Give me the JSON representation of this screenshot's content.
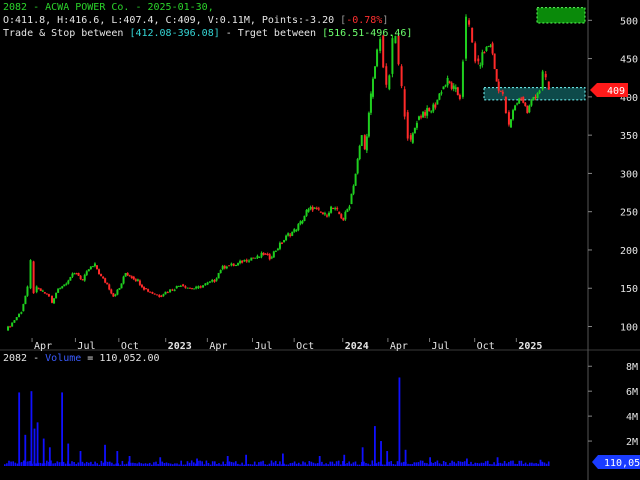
{
  "header": {
    "line1": "2082 - ACWA POWER Co. - 2025-01-30,",
    "ohlc": "O:411.8, H:416.6, L:407.4, C:409, V:0.11M, Points:-3.20 ",
    "pct_open": "[",
    "pct": "-0.78%",
    "pct_close": "]",
    "line3_a": "Trade & Stop between ",
    "stop_range": "[412.08-396.08]",
    "line3_b": " - Trget between ",
    "target_range": "[516.51-496.46]"
  },
  "volume_header": {
    "symbol": "2082 - ",
    "label": "Volume",
    "value": " = 110,052.00"
  },
  "colors": {
    "up": "#1fcf1f",
    "down": "#ff2a2a",
    "volume": "#1010ff",
    "target_zone": "#0a8a0a",
    "stop_zone": "#0e4a4a",
    "price_tag": "#ff1a1a",
    "volume_tag": "#1a3cff"
  },
  "chart_data": [
    {
      "type": "candlestick",
      "x_ticks": [
        "Apr",
        "Jul",
        "Oct",
        "2023",
        "Apr",
        "Jul",
        "Oct",
        "2024",
        "Apr",
        "Jul",
        "Oct",
        "2025"
      ],
      "y_ticks": [
        100,
        150,
        200,
        250,
        300,
        350,
        400,
        450,
        500
      ],
      "ylim": [
        85,
        520
      ],
      "last_price": 409,
      "last_price_label": "409",
      "target_zone": [
        496.46,
        516.51
      ],
      "stop_zone": [
        396.08,
        412.08
      ],
      "series_close": [
        [
          0,
          95
        ],
        [
          0.02,
          105
        ],
        [
          0.05,
          120
        ],
        [
          0.07,
          150
        ],
        [
          0.08,
          185
        ],
        [
          0.09,
          145
        ],
        [
          0.1,
          150
        ],
        [
          0.12,
          145
        ],
        [
          0.14,
          140
        ],
        [
          0.15,
          130
        ],
        [
          0.17,
          150
        ],
        [
          0.19,
          155
        ],
        [
          0.21,
          165
        ],
        [
          0.23,
          170
        ],
        [
          0.25,
          160
        ],
        [
          0.27,
          175
        ],
        [
          0.29,
          180
        ],
        [
          0.31,
          165
        ],
        [
          0.33,
          155
        ],
        [
          0.35,
          140
        ],
        [
          0.37,
          150
        ],
        [
          0.39,
          170
        ],
        [
          0.41,
          165
        ],
        [
          0.43,
          160
        ],
        [
          0.45,
          150
        ],
        [
          0.47,
          145
        ],
        [
          0.5,
          140
        ],
        [
          0.52,
          145
        ],
        [
          0.55,
          150
        ],
        [
          0.57,
          155
        ],
        [
          0.6,
          150
        ],
        [
          0.62,
          150
        ],
        [
          0.65,
          155
        ],
        [
          0.68,
          160
        ],
        [
          0.7,
          175
        ],
        [
          0.72,
          180
        ],
        [
          0.75,
          180
        ],
        [
          0.77,
          185
        ],
        [
          0.8,
          190
        ],
        [
          0.82,
          190
        ],
        [
          0.84,
          195
        ],
        [
          0.86,
          190
        ],
        [
          0.88,
          200
        ],
        [
          0.9,
          210
        ],
        [
          0.92,
          220
        ],
        [
          0.94,
          225
        ],
        [
          0.96,
          235
        ],
        [
          0.98,
          250
        ],
        [
          1.0,
          255
        ],
        [
          1.02,
          250
        ],
        [
          1.04,
          245
        ],
        [
          1.06,
          255
        ],
        [
          1.08,
          250
        ],
        [
          1.1,
          240
        ],
        [
          1.12,
          260
        ],
        [
          1.14,
          300
        ],
        [
          1.16,
          350
        ],
        [
          1.17,
          330
        ],
        [
          1.19,
          400
        ],
        [
          1.21,
          460
        ],
        [
          1.22,
          480
        ],
        [
          1.23,
          440
        ],
        [
          1.24,
          410
        ],
        [
          1.25,
          430
        ],
        [
          1.26,
          470
        ],
        [
          1.27,
          480
        ],
        [
          1.28,
          440
        ],
        [
          1.29,
          410
        ],
        [
          1.3,
          380
        ],
        [
          1.31,
          350
        ],
        [
          1.32,
          340
        ],
        [
          1.34,
          370
        ],
        [
          1.36,
          380
        ],
        [
          1.38,
          380
        ],
        [
          1.4,
          390
        ],
        [
          1.42,
          410
        ],
        [
          1.44,
          420
        ],
        [
          1.46,
          410
        ],
        [
          1.48,
          400
        ],
        [
          1.49,
          450
        ],
        [
          1.5,
          500
        ],
        [
          1.51,
          490
        ],
        [
          1.52,
          470
        ],
        [
          1.53,
          450
        ],
        [
          1.54,
          440
        ],
        [
          1.56,
          460
        ],
        [
          1.58,
          470
        ],
        [
          1.6,
          420
        ],
        [
          1.62,
          400
        ],
        [
          1.63,
          380
        ],
        [
          1.64,
          360
        ],
        [
          1.66,
          390
        ],
        [
          1.68,
          400
        ],
        [
          1.7,
          380
        ],
        [
          1.72,
          400
        ],
        [
          1.74,
          410
        ],
        [
          1.75,
          430
        ],
        [
          1.76,
          420
        ],
        [
          1.77,
          409
        ]
      ],
      "volume": {
        "label": "Volume",
        "y_ticks": [
          "2M",
          "4M",
          "6M",
          "8M"
        ],
        "last_value_label": "110,052",
        "spikes": [
          [
            0.04,
            5.9
          ],
          [
            0.06,
            2.5
          ],
          [
            0.08,
            6.0
          ],
          [
            0.09,
            3.0
          ],
          [
            0.1,
            3.5
          ],
          [
            0.12,
            2.2
          ],
          [
            0.14,
            1.5
          ],
          [
            0.18,
            5.9
          ],
          [
            0.2,
            1.8
          ],
          [
            0.24,
            1.2
          ],
          [
            0.32,
            1.7
          ],
          [
            0.36,
            1.2
          ],
          [
            0.4,
            0.8
          ],
          [
            0.5,
            0.7
          ],
          [
            0.62,
            0.6
          ],
          [
            0.72,
            0.8
          ],
          [
            0.78,
            0.9
          ],
          [
            0.9,
            1.0
          ],
          [
            1.02,
            0.8
          ],
          [
            1.1,
            0.9
          ],
          [
            1.16,
            1.5
          ],
          [
            1.2,
            3.2
          ],
          [
            1.22,
            2.0
          ],
          [
            1.24,
            1.2
          ],
          [
            1.28,
            7.1
          ],
          [
            1.3,
            1.3
          ],
          [
            1.38,
            0.7
          ],
          [
            1.5,
            0.6
          ],
          [
            1.6,
            0.7
          ],
          [
            1.74,
            0.5
          ]
        ],
        "ylim": [
          0,
          8.5
        ]
      }
    }
  ]
}
